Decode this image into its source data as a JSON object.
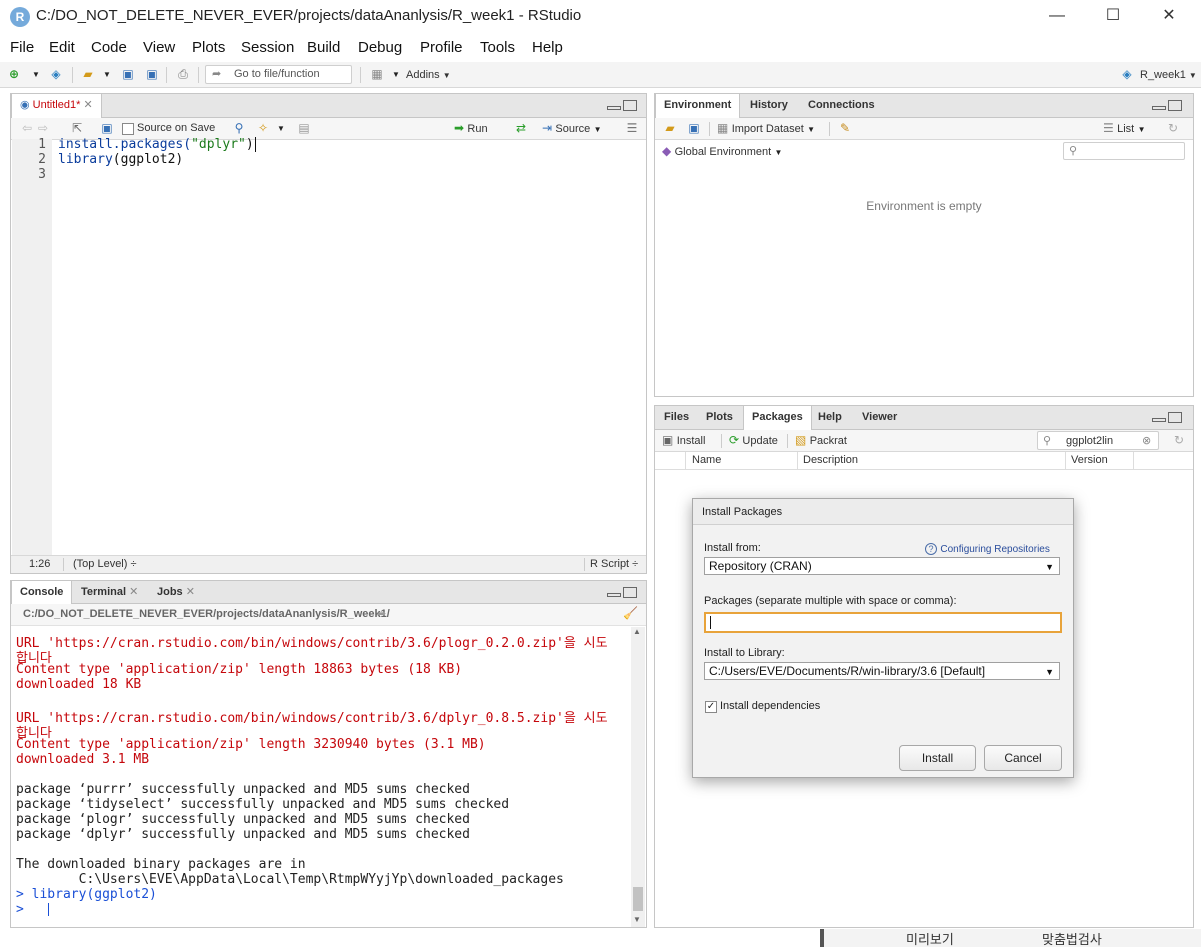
{
  "window": {
    "title": "C:/DO_NOT_DELETE_NEVER_EVER/projects/dataAnanlysis/R_week1 - RStudio",
    "minimize": "—",
    "maximize": "☐",
    "close": "✕"
  },
  "menu": [
    "File",
    "Edit",
    "Code",
    "View",
    "Plots",
    "Session",
    "Build",
    "Debug",
    "Profile",
    "Tools",
    "Help"
  ],
  "toolbar": {
    "goto_placeholder": "Go to file/function",
    "addins": "Addins",
    "project": "R_week1"
  },
  "editor": {
    "tab": "Untitled1*",
    "source_on_save": "Source on Save",
    "run": "Run",
    "source": "Source",
    "lines": [
      "1",
      "2",
      "3"
    ],
    "code": {
      "l1_fn": "install.packages(",
      "l1_str": "\"dplyr\"",
      "l1_end": ")",
      "l2_fn": "library",
      "l2_arg": "(ggplot2)"
    },
    "status_pos": "1:26",
    "status_scope": "(Top Level) ÷",
    "status_type": "R Script ÷"
  },
  "console": {
    "tabs": [
      "Console",
      "Terminal",
      "Jobs"
    ],
    "path": "C:/DO_NOT_DELETE_NEVER_EVER/projects/dataAnanlysis/R_week1/",
    "lines": [
      {
        "text": "URL 'https://cran.rstudio.com/bin/windows/contrib/3.6/plogr_0.2.0.zip'을 시도",
        "cls": "red"
      },
      {
        "text": "합니다",
        "cls": "red"
      },
      {
        "text": "Content type 'application/zip' length 18863 bytes (18 KB)",
        "cls": "red"
      },
      {
        "text": "downloaded 18 KB",
        "cls": "red"
      },
      {
        "text": "",
        "cls": ""
      },
      {
        "text": "URL 'https://cran.rstudio.com/bin/windows/contrib/3.6/dplyr_0.8.5.zip'을 시도",
        "cls": "red"
      },
      {
        "text": "합니다",
        "cls": "red"
      },
      {
        "text": "Content type 'application/zip' length 3230940 bytes (3.1 MB)",
        "cls": "red"
      },
      {
        "text": "downloaded 3.1 MB",
        "cls": "red"
      },
      {
        "text": "",
        "cls": ""
      },
      {
        "text": "package ‘purrr’ successfully unpacked and MD5 sums checked",
        "cls": ""
      },
      {
        "text": "package ‘tidyselect’ successfully unpacked and MD5 sums checked",
        "cls": ""
      },
      {
        "text": "package ‘plogr’ successfully unpacked and MD5 sums checked",
        "cls": ""
      },
      {
        "text": "package ‘dplyr’ successfully unpacked and MD5 sums checked",
        "cls": ""
      },
      {
        "text": "",
        "cls": ""
      },
      {
        "text": "The downloaded binary packages are in",
        "cls": ""
      },
      {
        "text": "        C:\\Users\\EVE\\AppData\\Local\\Temp\\RtmpWYyjYp\\downloaded_packages",
        "cls": ""
      },
      {
        "text": "> library(ggplot2)",
        "cls": "blue"
      },
      {
        "text": "> ",
        "cls": "blue"
      }
    ]
  },
  "environment": {
    "tabs": [
      "Environment",
      "History",
      "Connections"
    ],
    "import_dataset": "Import Dataset",
    "list": "List",
    "global_env": "Global Environment",
    "empty": "Environment is empty"
  },
  "files": {
    "tabs": [
      "Files",
      "Plots",
      "Packages",
      "Help",
      "Viewer"
    ],
    "install": "Install",
    "update": "Update",
    "packrat": "Packrat",
    "search_value": "ggplot2lin",
    "columns": [
      "Name",
      "Description",
      "Version"
    ]
  },
  "dialog": {
    "title": "Install Packages",
    "install_from_label": "Install from:",
    "configuring_link": "Configuring Repositories",
    "repository": "Repository (CRAN)",
    "packages_label": "Packages (separate multiple with space or comma):",
    "packages_value": "",
    "library_label": "Install to Library:",
    "library_value": "C:/Users/EVE/Documents/R/win-library/3.6 [Default]",
    "deps_label": "Install dependencies",
    "deps_checked": true,
    "install_btn": "Install",
    "cancel_btn": "Cancel"
  },
  "taskbar_fragments": [
    "미리보기",
    "맞춤법검사"
  ]
}
